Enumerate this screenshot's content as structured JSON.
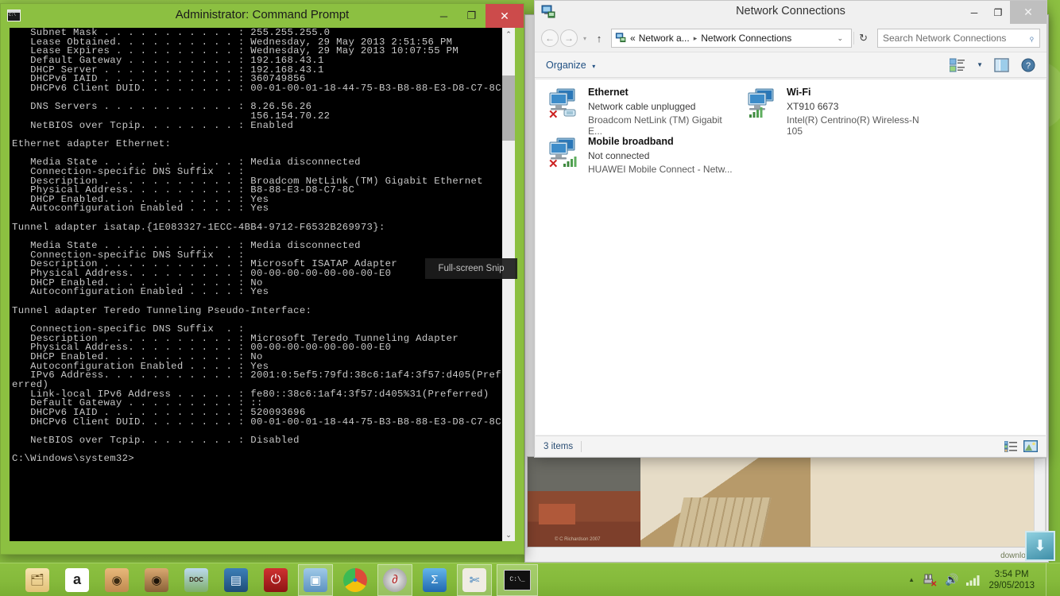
{
  "desktop": {
    "accent_color": "#8cc041",
    "shortcut": {
      "name": "download-shortcut",
      "glyph": "⬇"
    }
  },
  "background_window": {
    "photo_caption": "© C Richardson 2007",
    "scroll_glyph": "⌄",
    "footer_text": "download ..."
  },
  "command_prompt": {
    "title": "Administrator: Command Prompt",
    "icon": "console-icon",
    "window_buttons": {
      "minimize": "─",
      "maximize": "❐",
      "close": "✕"
    },
    "close_color": "#cc4b4b",
    "tooltip": "Full-screen Snip",
    "scrollbar": {
      "up": "⌃",
      "down": "⌄"
    },
    "console_text": "   Subnet Mask . . . . . . . . . . . : 255.255.255.0\n   Lease Obtained. . . . . . . . . . : Wednesday, 29 May 2013 2:51:56 PM\n   Lease Expires . . . . . . . . . . : Wednesday, 29 May 2013 10:07:55 PM\n   Default Gateway . . . . . . . . . : 192.168.43.1\n   DHCP Server . . . . . . . . . . . : 192.168.43.1\n   DHCPv6 IAID . . . . . . . . . . . : 360749856\n   DHCPv6 Client DUID. . . . . . . . : 00-01-00-01-18-44-75-B3-B8-88-E3-D8-C7-8C\n\n   DNS Servers . . . . . . . . . . . : 8.26.56.26\n                                       156.154.70.22\n   NetBIOS over Tcpip. . . . . . . . : Enabled\n\nEthernet adapter Ethernet:\n\n   Media State . . . . . . . . . . . : Media disconnected\n   Connection-specific DNS Suffix  . :\n   Description . . . . . . . . . . . : Broadcom NetLink (TM) Gigabit Ethernet\n   Physical Address. . . . . . . . . : B8-88-E3-D8-C7-8C\n   DHCP Enabled. . . . . . . . . . . : Yes\n   Autoconfiguration Enabled . . . . : Yes\n\nTunnel adapter isatap.{1E083327-1ECC-4BB4-9712-F6532B269973}:\n\n   Media State . . . . . . . . . . . : Media disconnected\n   Connection-specific DNS Suffix  . :\n   Description . . . . . . . . . . . : Microsoft ISATAP Adapter\n   Physical Address. . . . . . . . . : 00-00-00-00-00-00-00-E0\n   DHCP Enabled. . . . . . . . . . . : No\n   Autoconfiguration Enabled . . . . : Yes\n\nTunnel adapter Teredo Tunneling Pseudo-Interface:\n\n   Connection-specific DNS Suffix  . :\n   Description . . . . . . . . . . . : Microsoft Teredo Tunneling Adapter\n   Physical Address. . . . . . . . . : 00-00-00-00-00-00-00-E0\n   DHCP Enabled. . . . . . . . . . . : No\n   Autoconfiguration Enabled . . . . : Yes\n   IPv6 Address. . . . . . . . . . . : 2001:0:5ef5:79fd:38c6:1af4:3f57:d405(Pref\nerred)\n   Link-local IPv6 Address . . . . . : fe80::38c6:1af4:3f57:d405%31(Preferred)\n   Default Gateway . . . . . . . . . : ::\n   DHCPv6 IAID . . . . . . . . . . . : 520093696\n   DHCPv6 Client DUID. . . . . . . . : 00-01-00-01-18-44-75-B3-B8-88-E3-D8-C7-8C\n\n   NetBIOS over Tcpip. . . . . . . . : Disabled\n\nC:\\Windows\\system32>"
  },
  "network_connections": {
    "title": "Network Connections",
    "icon": "network-connections-icon",
    "window_buttons": {
      "minimize": "─",
      "maximize": "❐",
      "close": "✕"
    },
    "address_bar": {
      "back_glyph": "←",
      "forward_glyph": "→",
      "history_glyph": "▾",
      "up_glyph": "↑",
      "crumb_prefix": "«",
      "crumb_root": "Network a...",
      "crumb_separator": "▸",
      "crumb_current": "Network Connections",
      "dropdown_glyph": "⌄",
      "refresh_glyph": "↻"
    },
    "search": {
      "placeholder": "Search Network Connections",
      "icon": "search-icon"
    },
    "command_bar": {
      "organize_label": "Organize",
      "organize_caret": "▾",
      "view_icon": "view-options-icon",
      "view_caret": "▼",
      "pane_icon": "preview-pane-icon",
      "help_icon": "help-icon"
    },
    "adapters": [
      {
        "name": "Ethernet",
        "status": "Network cable unplugged",
        "device": "Broadcom NetLink (TM) Gigabit E...",
        "overlay": "error-x",
        "badge": "cable-icon"
      },
      {
        "name": "Wi-Fi",
        "status": "XT910 6673",
        "device": "Intel(R) Centrino(R) Wireless-N 105",
        "overlay": "none",
        "badge": "signal-bars"
      },
      {
        "name": "Mobile broadband",
        "status": "Not connected",
        "device": "HUAWEI Mobile Connect - Netw...",
        "overlay": "error-x",
        "badge": "signal-bars"
      }
    ],
    "status_bar": {
      "item_count": "3 items",
      "details_view_icon": "details-view-icon",
      "tiles_view_icon": "tiles-view-icon"
    }
  },
  "taskbar": {
    "buttons": [
      {
        "name": "file-explorer",
        "glyph": "🗂",
        "color": "#f0d089",
        "active": false
      },
      {
        "name": "amazon",
        "glyph": "a",
        "color": "#ffffff",
        "active": false
      },
      {
        "name": "clock-app",
        "glyph": "◉",
        "color": "#e0a765",
        "active": false
      },
      {
        "name": "speaker-app",
        "glyph": "◉",
        "color": "#c08a55",
        "active": false
      },
      {
        "name": "doc-app",
        "glyph": "DOC",
        "color": "#7fb4dd",
        "active": false
      },
      {
        "name": "settings-app",
        "glyph": "▤",
        "color": "#2f6fa8",
        "active": false
      },
      {
        "name": "power-app",
        "glyph": "⏻",
        "color": "#b32222",
        "active": false
      },
      {
        "name": "control-panel",
        "glyph": "▣",
        "color": "#6fa8d8",
        "active": true
      },
      {
        "name": "google-chrome",
        "glyph": "◉",
        "color": "#dd4b39",
        "active": false
      },
      {
        "name": "avant-browser",
        "glyph": "◉",
        "color": "#9c9c9c",
        "active": true
      },
      {
        "name": "powershell",
        "glyph": "Σ",
        "color": "#2f8fd8",
        "active": false
      },
      {
        "name": "snipping-tool",
        "glyph": "✄",
        "color": "#e8e8e8",
        "active": true
      },
      {
        "name": "command-prompt",
        "glyph": "C:\\_",
        "color": "#111111",
        "active": true
      }
    ],
    "tray": {
      "show_hidden_glyph": "▲",
      "network_icon": "network-unplugged-icon",
      "volume_icon": "volume-icon",
      "signal_icon": "signal-icon"
    },
    "clock": {
      "time": "3:54 PM",
      "date": "29/05/2013"
    }
  }
}
